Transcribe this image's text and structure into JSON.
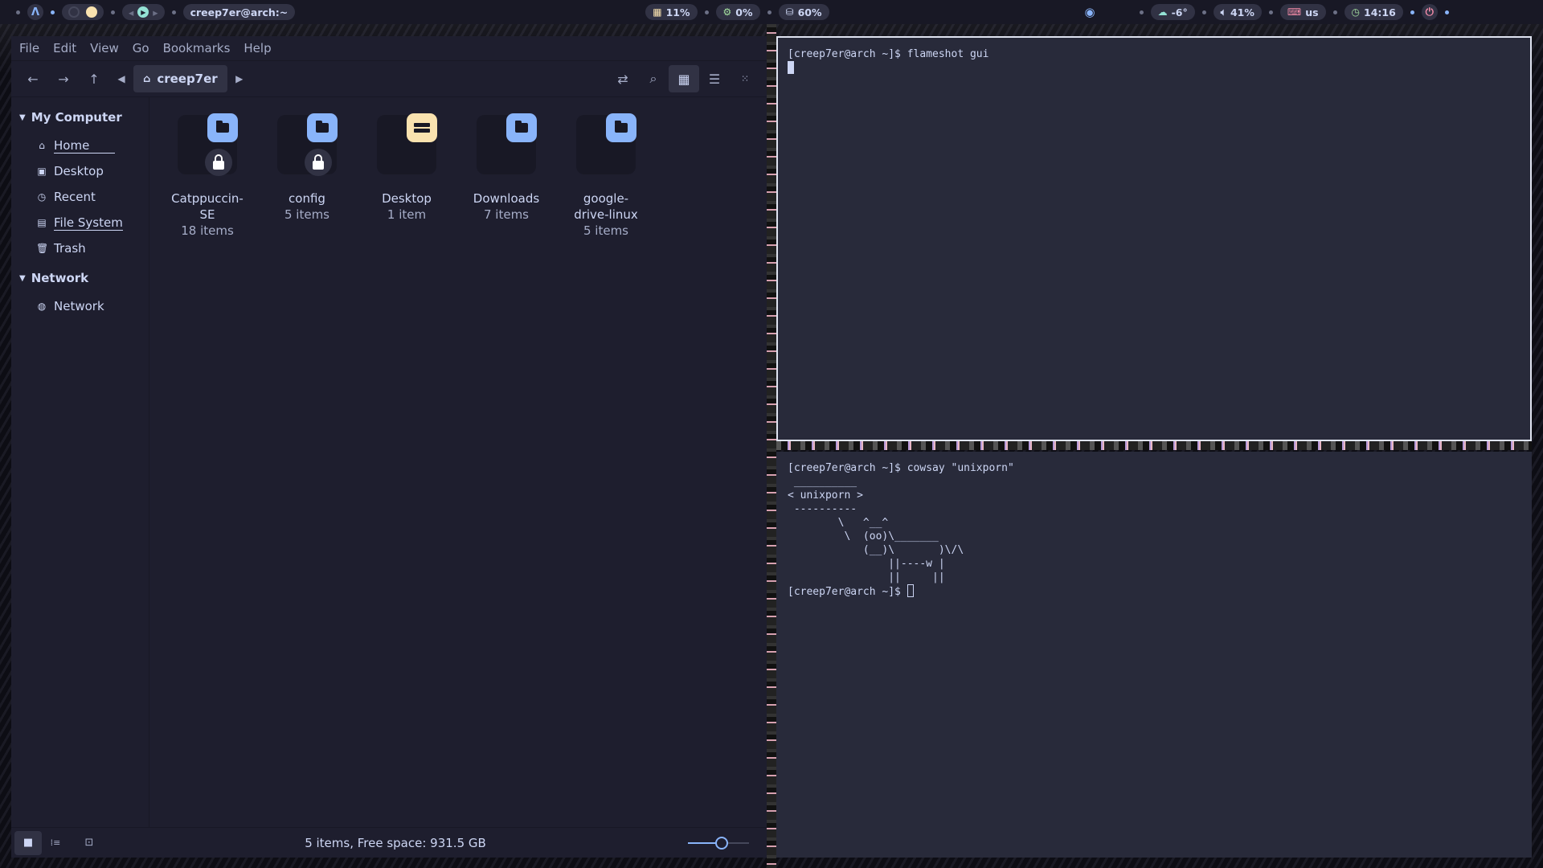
{
  "topbar": {
    "user_host": "creep7er@arch:~",
    "cpu": "11%",
    "gpu": "0%",
    "disk": "60%",
    "weather": "-6°",
    "volume": "41%",
    "keyboard_layout": "us",
    "clock": "14:16"
  },
  "file_manager": {
    "menu": [
      "File",
      "Edit",
      "View",
      "Go",
      "Bookmarks",
      "Help"
    ],
    "breadcrumb": "creep7er",
    "sidebar": {
      "my_computer_label": "My Computer",
      "items": [
        {
          "label": "Home",
          "icon": "home-icon"
        },
        {
          "label": "Desktop",
          "icon": "desktop-icon"
        },
        {
          "label": "Recent",
          "icon": "clock-icon"
        },
        {
          "label": "File System",
          "icon": "drive-icon"
        },
        {
          "label": "Trash",
          "icon": "trash-icon"
        }
      ],
      "network_label": "Network",
      "network_items": [
        {
          "label": "Network",
          "icon": "globe-icon"
        }
      ]
    },
    "files": [
      {
        "name": "Catppuccin-SE",
        "count": "18 items",
        "locked": true,
        "type": "folder"
      },
      {
        "name": "config",
        "count": "5 items",
        "locked": true,
        "type": "folder"
      },
      {
        "name": "Desktop",
        "count": "1 item",
        "locked": false,
        "type": "desktop"
      },
      {
        "name": "Downloads",
        "count": "7 items",
        "locked": false,
        "type": "folder"
      },
      {
        "name": "google-drive-linux",
        "count": "5 items",
        "locked": false,
        "type": "folder"
      }
    ],
    "status": "5 items, Free space: 931.5 GB",
    "zoom_level_fraction": 0.55
  },
  "terminal_top": {
    "prompt": "[creep7er@arch ~]$ ",
    "command": "flameshot gui"
  },
  "terminal_bottom": {
    "prompt": "[creep7er@arch ~]$ ",
    "command": "cowsay \"unixporn\"",
    "output": " __________\n< unixporn >\n ----------\n        \\   ^__^\n         \\  (oo)\\_______\n            (__)\\       )\\/\\\n                ||----w |\n                ||     ||",
    "prompt2": "[creep7er@arch ~]$ "
  },
  "colors": {
    "accent": "#89b4fa",
    "yellow": "#f9e2af",
    "bg": "#1e1e2e",
    "surface": "#313244"
  }
}
